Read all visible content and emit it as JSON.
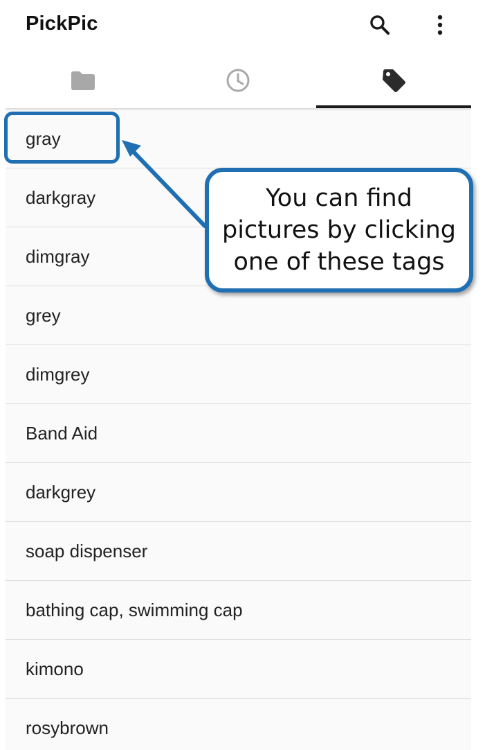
{
  "app": {
    "title": "PickPic"
  },
  "toolbar": {
    "icons": [
      "search-icon",
      "more-vert-icon"
    ]
  },
  "tabs": [
    {
      "icon": "folder-icon",
      "selected": false
    },
    {
      "icon": "clock-icon",
      "selected": false
    },
    {
      "icon": "tag-icon",
      "selected": true
    }
  ],
  "tags": [
    "gray",
    "darkgray",
    "dimgray",
    "grey",
    "dimgrey",
    "Band Aid",
    "darkgrey",
    "soap dispenser",
    "bathing cap, swimming cap",
    "kimono",
    "rosybrown"
  ],
  "annotation": {
    "callout_lines": [
      "You can find",
      "pictures by clicking",
      "one of these tags"
    ],
    "color": "#1f6fb2"
  },
  "colors": {
    "icon_inactive": "#a8a8a8",
    "icon_active": "#2b2b2b",
    "indicator": "#1a1a1a"
  }
}
